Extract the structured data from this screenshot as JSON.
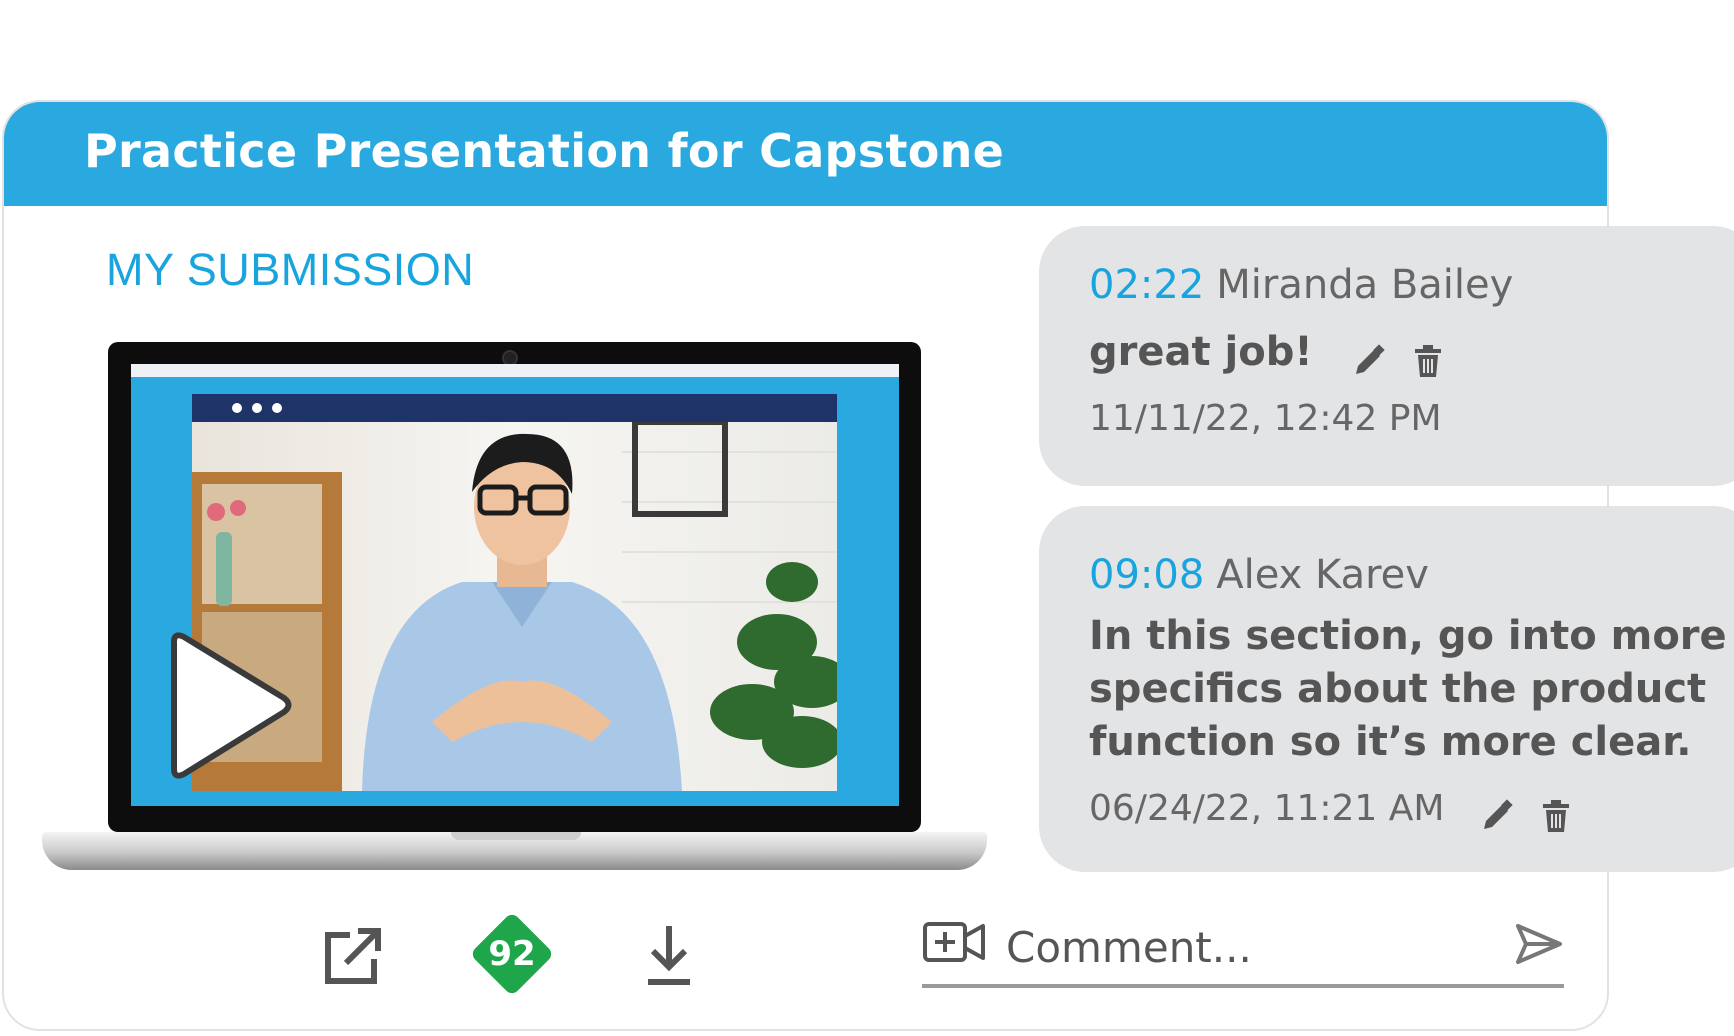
{
  "header": {
    "title": "Practice Presentation for Capstone"
  },
  "submission": {
    "label": "MY SUBMISSION"
  },
  "actions": {
    "grade": "92"
  },
  "comment_bar": {
    "placeholder": "Comment..."
  },
  "comments": [
    {
      "timestamp": "02:22",
      "author": "Miranda Bailey",
      "text": "great job!",
      "date": "11/11/22, 12:42 PM"
    },
    {
      "timestamp": "09:08",
      "author": "Alex Karev",
      "text_lines": [
        "In this section, go into more",
        "specifics about the product",
        "function so it’s more clear."
      ],
      "date": "06/24/22, 11:21 AM"
    }
  ],
  "colors": {
    "header": "#2aa9e0",
    "accent": "#1aa4de",
    "grade": "#1fa64a",
    "bubble": "#e3e4e6",
    "video_bar": "#1e3468"
  },
  "icons": [
    "play-icon",
    "open-external-icon",
    "download-icon",
    "add-video-icon",
    "send-icon",
    "edit-icon",
    "delete-icon"
  ]
}
